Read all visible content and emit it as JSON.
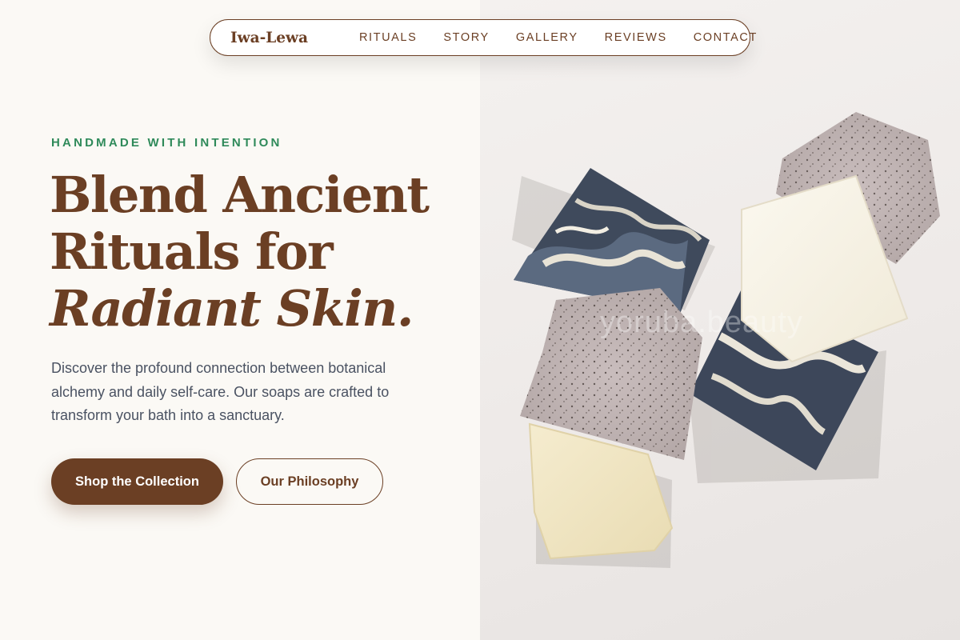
{
  "nav": {
    "logo": "Iwa-Lewa",
    "links": [
      {
        "label": "RITUALS"
      },
      {
        "label": "STORY"
      },
      {
        "label": "GALLERY"
      },
      {
        "label": "REVIEWS"
      },
      {
        "label": "CONTACT"
      }
    ]
  },
  "hero": {
    "eyebrow": "HANDMADE WITH INTENTION",
    "headline_line1": "Blend Ancient",
    "headline_line2": "Rituals for",
    "headline_line3": "Radiant Skin.",
    "description": "Discover the profound connection between botanical alchemy and daily self-care. Our soaps are crafted to transform your bath into a sanctuary.",
    "primary_button": "Shop the Collection",
    "secondary_button": "Our Philosophy"
  },
  "image": {
    "watermark": "yoruba.beauty"
  },
  "colors": {
    "brand_brown": "#6b3f24",
    "accent_green": "#2f8a5a",
    "background": "#fbf9f5",
    "body_text": "#4a5262"
  }
}
